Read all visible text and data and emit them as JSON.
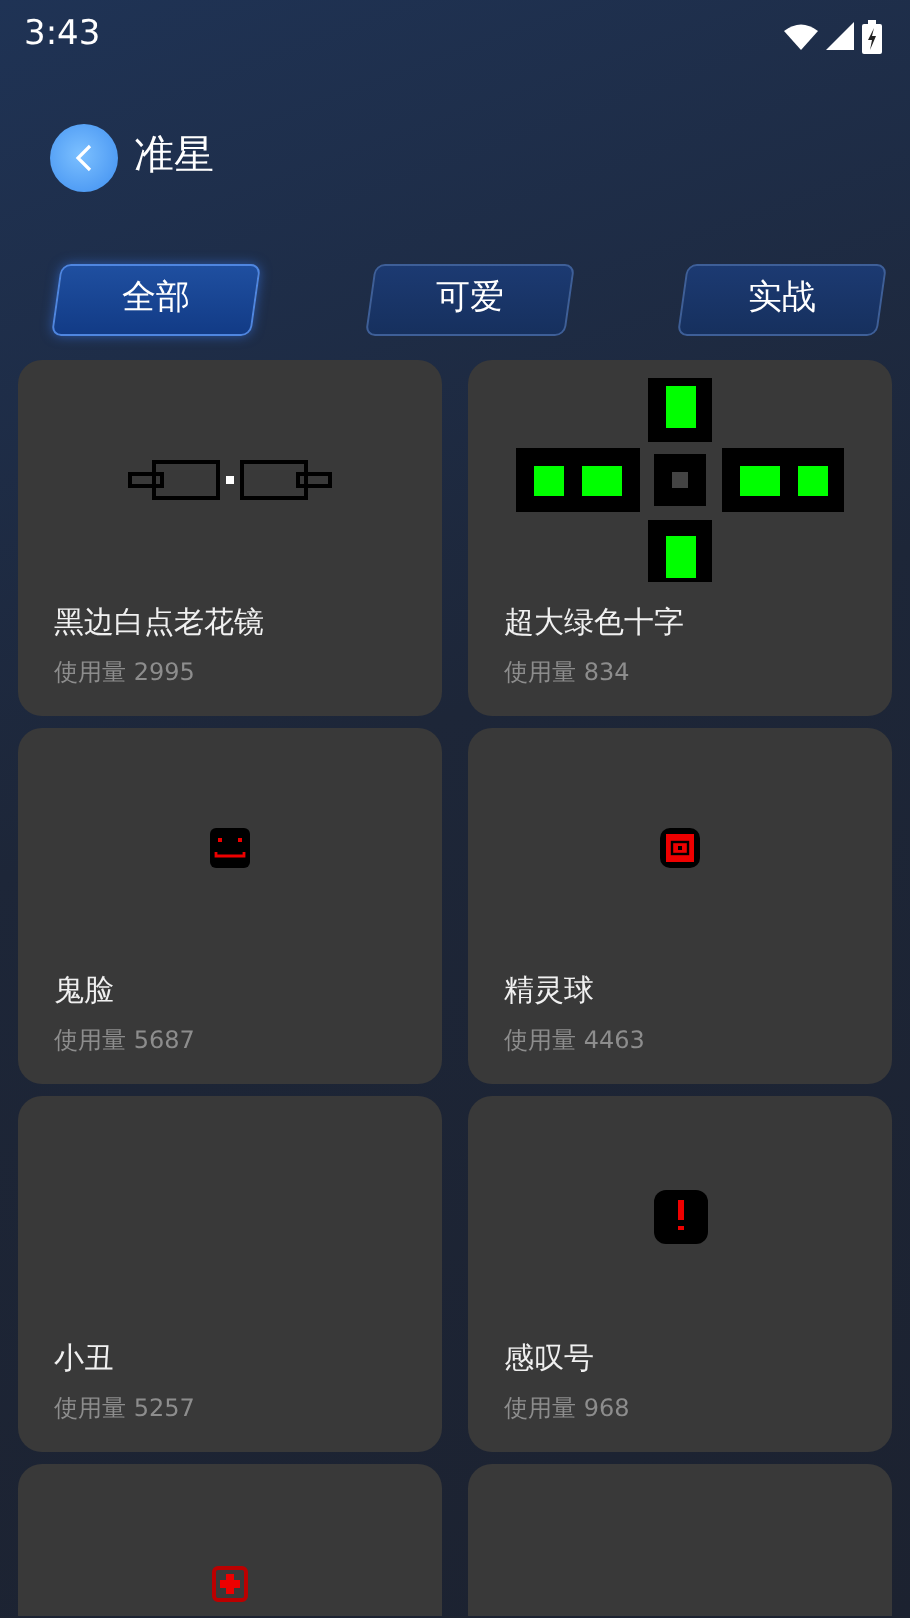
{
  "status_bar": {
    "time": "3:43"
  },
  "header": {
    "title": "准星"
  },
  "tabs": [
    {
      "label": "全部",
      "selected": true
    },
    {
      "label": "可爱",
      "selected": false
    },
    {
      "label": "实战",
      "selected": false
    }
  ],
  "crosshairs": [
    {
      "kind": "glasses",
      "name": "黑边白点老花镜",
      "usage": "使用量 2995"
    },
    {
      "kind": "cross",
      "name": "超大绿色十字",
      "usage": "使用量 834"
    },
    {
      "kind": "face",
      "name": "鬼脸",
      "usage": "使用量 5687"
    },
    {
      "kind": "ball",
      "name": "精灵球",
      "usage": "使用量 4463"
    },
    {
      "kind": "blank",
      "name": "小丑",
      "usage": "使用量 5257"
    },
    {
      "kind": "exclaim",
      "name": "感叹号",
      "usage": "使用量 968"
    },
    {
      "kind": "medic"
    },
    {
      "kind": "blank"
    }
  ]
}
